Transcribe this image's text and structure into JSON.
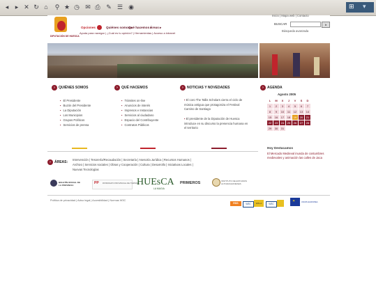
{
  "browser": {
    "toolbar_icons": [
      "back-icon",
      "forward-icon",
      "stop-icon",
      "refresh-icon",
      "home-icon",
      "search-icon",
      "favorites-icon",
      "history-icon",
      "mail-icon",
      "print-icon",
      "edit-icon",
      "discuss-icon",
      "messenger-icon"
    ]
  },
  "site": {
    "logo_text": "DIPUTACIÓN DE HUESCA",
    "top_links": "Inicio | Mapa web | Contacto",
    "search_label": "BUSCAR",
    "search_button": "Ir",
    "advanced_search": "Búsqueda avanzada",
    "nav": [
      "Opciones",
      "Quiénes somos ▸",
      "Qué hacemos ▸",
      "Áreas ▸"
    ],
    "subnav": "Ayuda para navegar | ¿Cuál es tu opinión? | Herramientas | Acceso a intranet"
  },
  "sections": {
    "quienes": {
      "title": "QUIÉNES SOMOS",
      "items": [
        "El Presidente",
        "Buzón del Presidente",
        "La Diputación",
        "Los Municipios",
        "Grupos Políticos",
        "Servicios de prensa"
      ]
    },
    "que": {
      "title": "QUÉ HACEMOS",
      "items": [
        "Trámites on-line",
        "Anuncios de interés",
        "Impresos e Instancias",
        "Servicios al ciudadano",
        "Espacio del Contribuyente",
        "Contratos Públicos"
      ]
    },
    "noticias": {
      "title": "NOTICIAS Y NOVEDADES",
      "items": [
        "El coro The Tallis Scholars cierra el ciclo de música antigua que protagoniza el Festival Camino de Santiago",
        "El presidente de la Diputación de Huesca introduce en su discurso la presencia humana en el territorio"
      ]
    },
    "agenda": {
      "title": "AGENDA",
      "month": "Agosto 2005",
      "days": [
        "L",
        "M",
        "X",
        "J",
        "V",
        "S",
        "D"
      ],
      "weeks": [
        [
          "1",
          "2",
          "3",
          "4",
          "5",
          "6",
          "7"
        ],
        [
          "8",
          "9",
          "10",
          "11",
          "12",
          "13",
          "14"
        ],
        [
          "15",
          "16",
          "17",
          "18",
          "19",
          "20",
          "21"
        ],
        [
          "22",
          "23",
          "24",
          "25",
          "26",
          "27",
          "28"
        ],
        [
          "29",
          "30",
          "31",
          "",
          "",
          "",
          ""
        ]
      ]
    },
    "destacamos": {
      "title": "Hoy Destacamos",
      "text": "El Mercado Medieval inunda de costumbres medievales y animación las calles de Jaca"
    }
  },
  "areas": {
    "label": "ÁREAS:",
    "line1": "Intervención | Tesorería/Recaudación | Secretaría | Asesoría Jurídica | Recursos Humanos |",
    "line2": "Archivo | Servicios sociales | Obras y Cooperación | Cultura | Desarrollo | Iniciativas Locales |",
    "line3": "Nuevas Tecnologías"
  },
  "partners": {
    "bop": "BOLETÍN OFICIAL DE LA PROVINCIA",
    "pp": "PATRONATO PROVINCIAL DE TURISMO",
    "huesca": "HUEsCA",
    "huesca_sub": "LA MAGIA",
    "primeros": "PRIMEROS",
    "instituto": "INSTITUTO DE ESTUDIOS ALTOARAGONESES"
  },
  "footer": {
    "links": "Política de privacidad | Aviso legal | Accesibilidad | Normas W3C",
    "badges": [
      "RSS",
      "W3C",
      "WAI-A",
      "W3C",
      "UNION EUROPEA"
    ]
  }
}
